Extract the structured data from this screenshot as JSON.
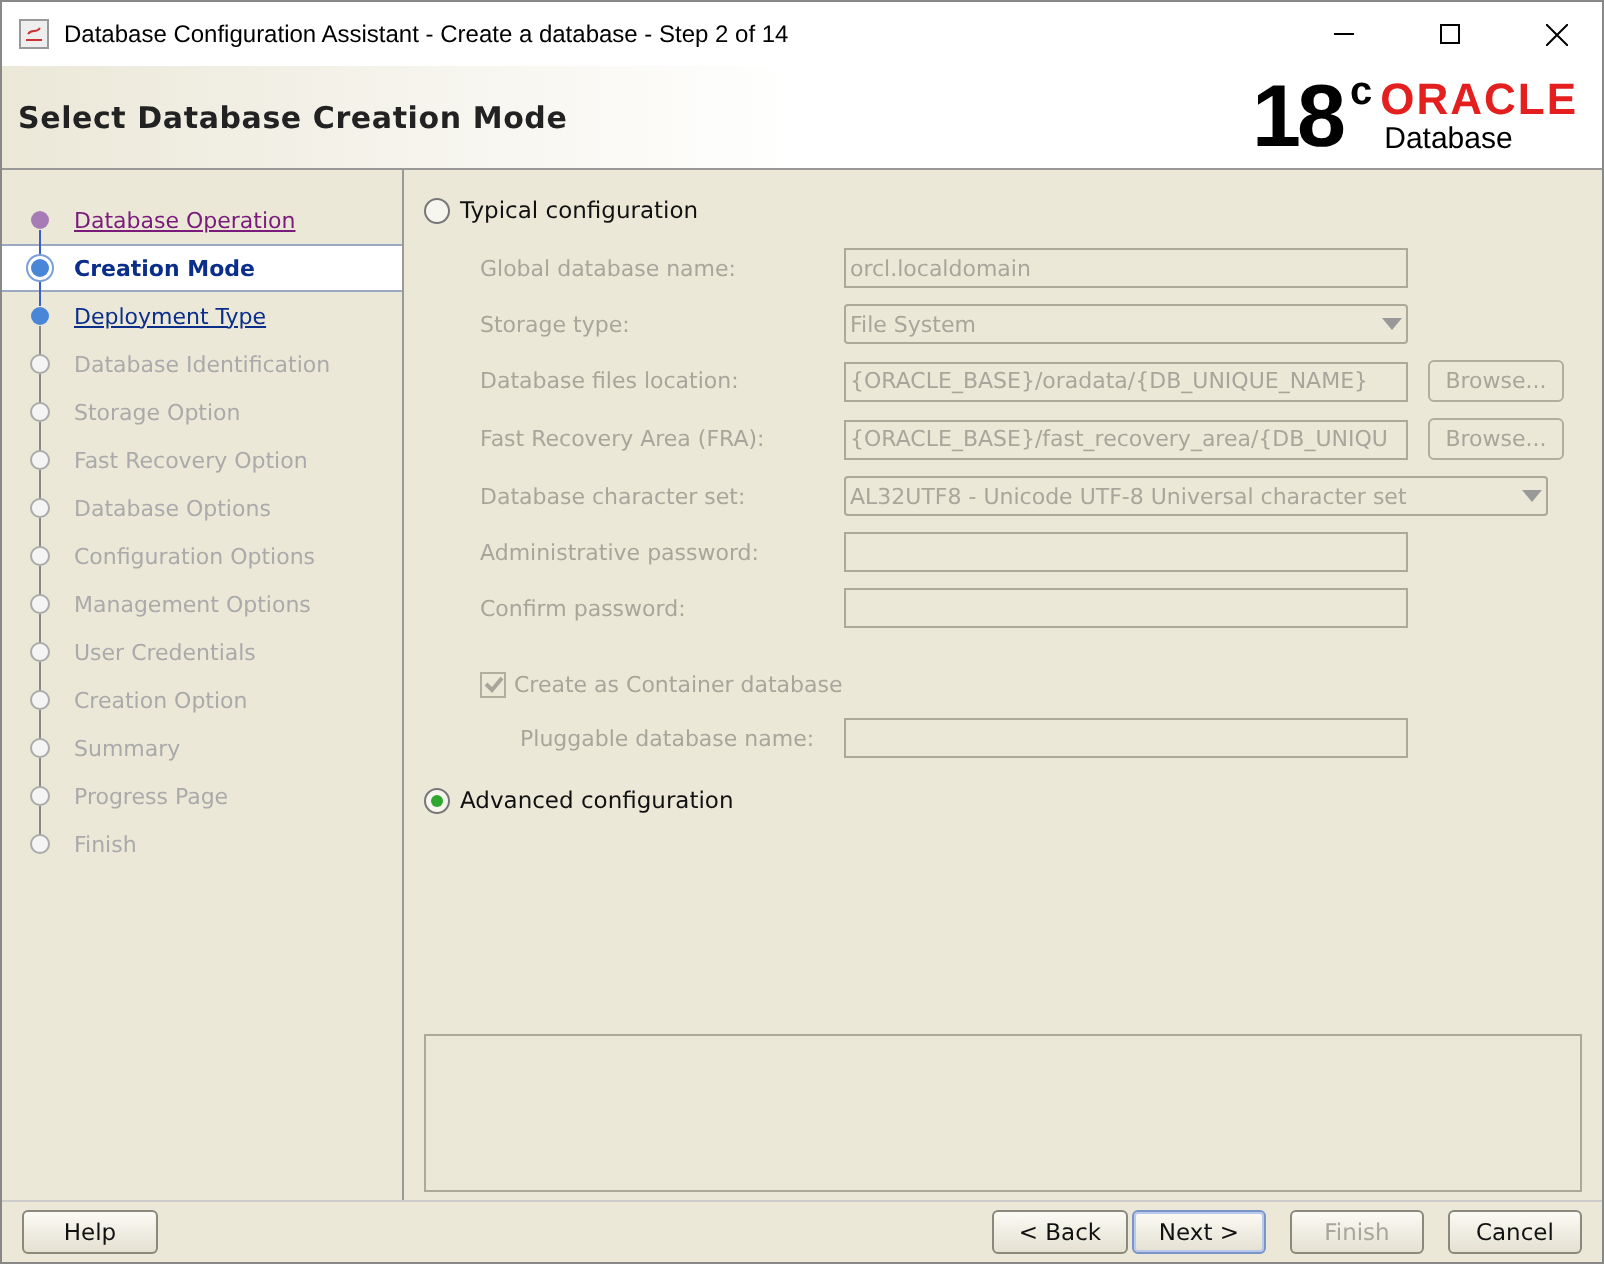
{
  "window": {
    "title": "Database Configuration Assistant - Create a database - Step 2 of 14"
  },
  "header": {
    "title": "Select Database Creation Mode",
    "logo": {
      "version": "18",
      "superscript": "c",
      "brand": "ORACLE",
      "product": "Database"
    }
  },
  "steps": [
    {
      "label": "Database Operation",
      "kind": "visited",
      "selected": false
    },
    {
      "label": "Creation Mode",
      "kind": "current",
      "selected": true
    },
    {
      "label": "Deployment Type",
      "kind": "available",
      "selected": false
    },
    {
      "label": "Database Identification",
      "kind": "disabled",
      "selected": false
    },
    {
      "label": "Storage Option",
      "kind": "disabled",
      "selected": false
    },
    {
      "label": "Fast Recovery Option",
      "kind": "disabled",
      "selected": false
    },
    {
      "label": "Database Options",
      "kind": "disabled",
      "selected": false
    },
    {
      "label": "Configuration Options",
      "kind": "disabled",
      "selected": false
    },
    {
      "label": "Management Options",
      "kind": "disabled",
      "selected": false
    },
    {
      "label": "User Credentials",
      "kind": "disabled",
      "selected": false
    },
    {
      "label": "Creation Option",
      "kind": "disabled",
      "selected": false
    },
    {
      "label": "Summary",
      "kind": "disabled",
      "selected": false
    },
    {
      "label": "Progress Page",
      "kind": "disabled",
      "selected": false
    },
    {
      "label": "Finish",
      "kind": "disabled",
      "selected": false
    }
  ],
  "modes": [
    {
      "label": "Typical configuration",
      "selected": false
    },
    {
      "label": "Advanced configuration",
      "selected": true
    }
  ],
  "typical_fields": [
    {
      "kind": "text",
      "label": "Global database name:",
      "value": "orcl.localdomain",
      "disabled": true
    },
    {
      "kind": "select",
      "label": "Storage type:",
      "value": "File System",
      "disabled": true
    },
    {
      "kind": "path",
      "label": "Database files location:",
      "value": "{ORACLE_BASE}/oradata/{DB_UNIQUE_NAME}",
      "button": "Browse...",
      "disabled": true
    },
    {
      "kind": "path",
      "label": "Fast Recovery Area (FRA):",
      "value": "{ORACLE_BASE}/fast_recovery_area/{DB_UNIQU",
      "button": "Browse...",
      "disabled": true
    },
    {
      "kind": "wideselect",
      "label": "Database character set:",
      "value": "AL32UTF8 - Unicode UTF-8 Universal character set",
      "disabled": true
    },
    {
      "kind": "text",
      "label": "Administrative password:",
      "disabled": true
    },
    {
      "kind": "text",
      "label": "Confirm password:",
      "disabled": true
    }
  ],
  "container": {
    "label": "Create as Container database",
    "checked": true,
    "disabled": true,
    "field": {
      "label": "Pluggable database name:",
      "disabled": true
    }
  },
  "buttons": [
    {
      "label": "Help",
      "disabled": false,
      "default": false
    },
    {
      "label": "< Back",
      "disabled": false,
      "default": false
    },
    {
      "label": "Next >",
      "disabled": false,
      "default": true
    },
    {
      "label": "Finish",
      "disabled": true,
      "default": false
    },
    {
      "label": "Cancel",
      "disabled": false,
      "default": false
    }
  ]
}
